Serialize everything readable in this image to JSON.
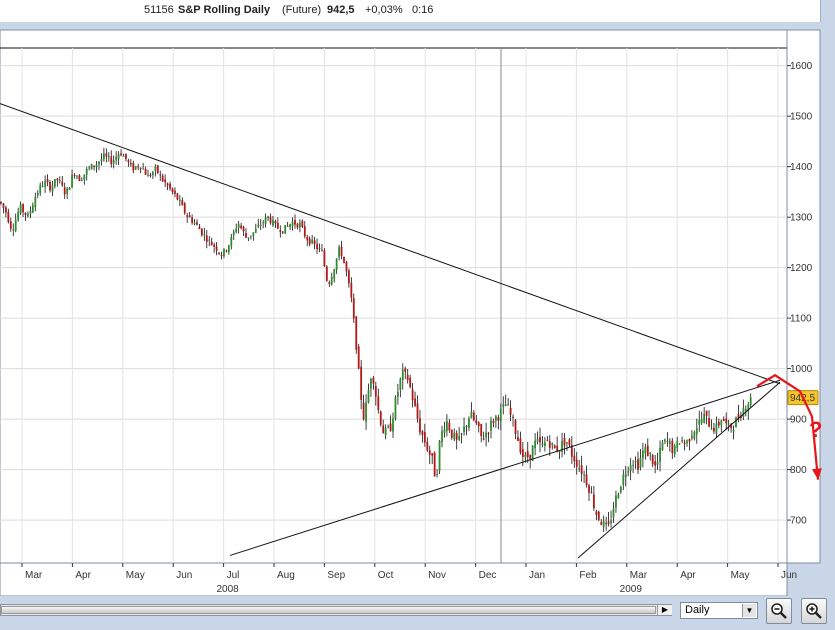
{
  "header": {
    "code": "51156",
    "name": "S&P Rolling Daily",
    "type": "(Future)",
    "price": "942,5",
    "change": "+0,03%",
    "time": "0:16"
  },
  "colors": {
    "up": "#2e8b2e",
    "down": "#b01818",
    "wick": "#111111",
    "annotation": "#e8141a",
    "price_label_bg": "#f6c52a"
  },
  "toolbar": {
    "timeframe": "Daily",
    "zoom_out_icon": "zoom-out-icon",
    "zoom_in_icon": "zoom-in-icon"
  },
  "chart_data": {
    "type": "candlestick",
    "title": "S&P Rolling Daily",
    "price_label": "942,5",
    "y_ticks": [
      700,
      800,
      900,
      1000,
      1100,
      1200,
      1300,
      1400,
      1500,
      1600
    ],
    "ylim": [
      615,
      1635
    ],
    "months": [
      "Mar",
      "Apr",
      "May",
      "Jun",
      "Jul",
      "Aug",
      "Sep",
      "Oct",
      "Nov",
      "Dec",
      "Jan",
      "Feb",
      "Mar",
      "Apr",
      "May",
      "Jun"
    ],
    "years": [
      {
        "label": "2008",
        "month_index": 4
      },
      {
        "label": "2009",
        "month_index": 12
      }
    ],
    "year_divider_month_index": 10,
    "path_anchors": [
      [
        0,
        1330
      ],
      [
        6,
        1310
      ],
      [
        12,
        1275
      ],
      [
        20,
        1320
      ],
      [
        28,
        1300
      ],
      [
        36,
        1345
      ],
      [
        44,
        1370
      ],
      [
        50,
        1360
      ],
      [
        58,
        1375
      ],
      [
        66,
        1345
      ],
      [
        74,
        1390
      ],
      [
        80,
        1375
      ],
      [
        88,
        1395
      ],
      [
        96,
        1405
      ],
      [
        104,
        1420
      ],
      [
        112,
        1410
      ],
      [
        120,
        1430
      ],
      [
        126,
        1415
      ],
      [
        132,
        1395
      ],
      [
        140,
        1405
      ],
      [
        148,
        1380
      ],
      [
        156,
        1395
      ],
      [
        162,
        1375
      ],
      [
        170,
        1355
      ],
      [
        178,
        1335
      ],
      [
        186,
        1305
      ],
      [
        194,
        1290
      ],
      [
        202,
        1270
      ],
      [
        210,
        1250
      ],
      [
        216,
        1240
      ],
      [
        222,
        1225
      ],
      [
        230,
        1250
      ],
      [
        238,
        1290
      ],
      [
        246,
        1260
      ],
      [
        254,
        1270
      ],
      [
        260,
        1285
      ],
      [
        268,
        1300
      ],
      [
        276,
        1280
      ],
      [
        284,
        1275
      ],
      [
        292,
        1290
      ],
      [
        300,
        1285
      ],
      [
        306,
        1260
      ],
      [
        314,
        1245
      ],
      [
        322,
        1230
      ],
      [
        328,
        1165
      ],
      [
        334,
        1200
      ],
      [
        340,
        1240
      ],
      [
        346,
        1195
      ],
      [
        352,
        1130
      ],
      [
        356,
        1050
      ],
      [
        360,
        960
      ],
      [
        364,
        900
      ],
      [
        368,
        950
      ],
      [
        372,
        1000
      ],
      [
        378,
        920
      ],
      [
        384,
        870
      ],
      [
        390,
        880
      ],
      [
        396,
        940
      ],
      [
        402,
        990
      ],
      [
        408,
        980
      ],
      [
        414,
        930
      ],
      [
        420,
        880
      ],
      [
        426,
        850
      ],
      [
        432,
        820
      ],
      [
        436,
        780
      ],
      [
        440,
        860
      ],
      [
        446,
        900
      ],
      [
        452,
        870
      ],
      [
        458,
        850
      ],
      [
        464,
        880
      ],
      [
        470,
        910
      ],
      [
        476,
        890
      ],
      [
        482,
        860
      ],
      [
        488,
        880
      ],
      [
        494,
        900
      ],
      [
        500,
        910
      ],
      [
        506,
        930
      ],
      [
        512,
        900
      ],
      [
        518,
        860
      ],
      [
        524,
        820
      ],
      [
        530,
        830
      ],
      [
        536,
        855
      ],
      [
        542,
        845
      ],
      [
        548,
        860
      ],
      [
        554,
        840
      ],
      [
        560,
        845
      ],
      [
        566,
        860
      ],
      [
        572,
        830
      ],
      [
        578,
        810
      ],
      [
        584,
        790
      ],
      [
        590,
        760
      ],
      [
        596,
        715
      ],
      [
        602,
        695
      ],
      [
        608,
        680
      ],
      [
        614,
        730
      ],
      [
        620,
        770
      ],
      [
        626,
        800
      ],
      [
        632,
        820
      ],
      [
        638,
        810
      ],
      [
        644,
        840
      ],
      [
        650,
        830
      ],
      [
        656,
        800
      ],
      [
        662,
        850
      ],
      [
        668,
        855
      ],
      [
        674,
        835
      ],
      [
        680,
        860
      ],
      [
        686,
        850
      ],
      [
        692,
        875
      ],
      [
        698,
        890
      ],
      [
        704,
        905
      ],
      [
        710,
        890
      ],
      [
        716,
        880
      ],
      [
        722,
        905
      ],
      [
        728,
        880
      ],
      [
        734,
        890
      ],
      [
        740,
        910
      ],
      [
        746,
        930
      ],
      [
        752,
        940
      ]
    ],
    "trendlines": [
      {
        "p1": [
          0,
          1525
        ],
        "p2": [
          780,
          970
        ]
      },
      {
        "p1": [
          230,
          630
        ],
        "p2": [
          780,
          977
        ]
      },
      {
        "p1": [
          578,
          625
        ],
        "p2": [
          780,
          973
        ]
      }
    ],
    "annotations": {
      "question_mark": "?",
      "forecast_path": [
        [
          757,
          965
        ],
        [
          775,
          987
        ],
        [
          800,
          955
        ],
        [
          812,
          905
        ],
        [
          818,
          780
        ]
      ]
    }
  }
}
